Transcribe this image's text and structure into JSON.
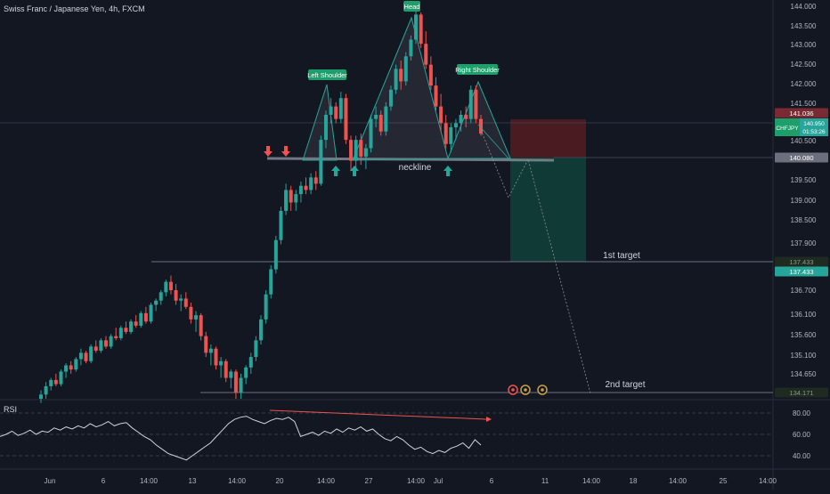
{
  "header": {
    "symbol_title": "Swiss Franc / Japanese Yen, 4h, FXCM"
  },
  "rsi": {
    "label": "RSI",
    "levels": [
      "80.00",
      "60.00",
      "40.00"
    ]
  },
  "colors": {
    "background": "#131722",
    "up": "#26a69a",
    "down": "#ef5350",
    "pattern_line": "#26a69a",
    "label_bg": "#1e9e6a",
    "stop_zone": "#4a1c22",
    "target_zone": "#0f3a36",
    "rsi_line": "#d1d4dc",
    "divergence": "#ef5350"
  },
  "chart_data": {
    "type": "candlestick",
    "title": "Swiss Franc / Japanese Yen, 4h, FXCM",
    "y_axis": {
      "range": [
        134.6,
        144.0
      ],
      "ticks": [
        "144.000",
        "143.500",
        "143.000",
        "142.500",
        "142.000",
        "141.500",
        "140.500",
        "139.500",
        "139.000",
        "138.500",
        "137.900",
        "136.700",
        "136.100",
        "135.600",
        "135.100",
        "134.650"
      ],
      "tick_values": [
        144.0,
        143.5,
        143.0,
        142.5,
        142.0,
        141.5,
        140.5,
        139.5,
        139.0,
        138.5,
        137.9,
        136.7,
        136.1,
        135.6,
        135.1,
        134.65
      ]
    },
    "x_axis": {
      "ticks": [
        "Jun",
        "6",
        "14:00",
        "13",
        "14:00",
        "20",
        "14:00",
        "27",
        "14:00",
        "Jul",
        "6",
        "11",
        "14:00",
        "18",
        "14:00",
        "25",
        "14:00"
      ]
    },
    "price_labels": {
      "stop": "141.036",
      "symbol": "CHFJPY",
      "last_price": "140.950",
      "countdown": "01:53:26",
      "neckline": "140.080",
      "first_target_a": "137.433",
      "first_target_b": "137.433",
      "second_target": "134.171"
    },
    "annotations": {
      "head": "Head",
      "left_shoulder": "Left Shoulder",
      "right_shoulder": "Right Shoulder",
      "neckline": "neckline",
      "first_target": "1st target",
      "second_target": "2nd target"
    },
    "candles_ohlc": [
      [
        134.6,
        134.8,
        134.5,
        134.7
      ],
      [
        134.7,
        135.0,
        134.6,
        134.9
      ],
      [
        134.9,
        135.1,
        134.8,
        135.05
      ],
      [
        135.05,
        135.2,
        134.9,
        134.95
      ],
      [
        134.95,
        135.3,
        134.9,
        135.25
      ],
      [
        135.25,
        135.45,
        135.1,
        135.4
      ],
      [
        135.4,
        135.5,
        135.2,
        135.3
      ],
      [
        135.3,
        135.6,
        135.25,
        135.55
      ],
      [
        135.55,
        135.8,
        135.4,
        135.7
      ],
      [
        135.7,
        135.75,
        135.45,
        135.5
      ],
      [
        135.5,
        135.9,
        135.45,
        135.85
      ],
      [
        135.85,
        136.0,
        135.7,
        135.75
      ],
      [
        135.75,
        136.05,
        135.7,
        136.0
      ],
      [
        136.0,
        136.1,
        135.8,
        135.85
      ],
      [
        135.85,
        136.15,
        135.8,
        136.1
      ],
      [
        136.1,
        136.3,
        136.0,
        136.05
      ],
      [
        136.05,
        136.35,
        136.0,
        136.3
      ],
      [
        136.3,
        136.45,
        136.15,
        136.2
      ],
      [
        136.2,
        136.5,
        136.15,
        136.45
      ],
      [
        136.45,
        136.6,
        136.3,
        136.35
      ],
      [
        136.35,
        136.7,
        136.3,
        136.65
      ],
      [
        136.65,
        136.8,
        136.4,
        136.45
      ],
      [
        136.45,
        136.9,
        136.4,
        136.85
      ],
      [
        136.85,
        137.0,
        136.7,
        136.95
      ],
      [
        136.95,
        137.2,
        136.85,
        137.15
      ],
      [
        137.15,
        137.45,
        137.05,
        137.4
      ],
      [
        137.4,
        137.55,
        137.1,
        137.2
      ],
      [
        137.2,
        137.35,
        136.85,
        136.95
      ],
      [
        136.95,
        137.1,
        136.7,
        137.0
      ],
      [
        137.0,
        137.15,
        136.75,
        136.8
      ],
      [
        136.8,
        136.9,
        136.4,
        136.5
      ],
      [
        136.5,
        136.7,
        136.2,
        136.6
      ],
      [
        136.6,
        136.65,
        136.0,
        136.1
      ],
      [
        136.1,
        136.2,
        135.6,
        135.7
      ],
      [
        135.7,
        135.9,
        135.4,
        135.8
      ],
      [
        135.8,
        135.85,
        135.3,
        135.4
      ],
      [
        135.4,
        135.6,
        135.1,
        135.5
      ],
      [
        135.5,
        135.55,
        135.0,
        135.1
      ],
      [
        135.1,
        135.3,
        134.85,
        135.25
      ],
      [
        135.25,
        135.3,
        134.6,
        134.75
      ],
      [
        134.75,
        135.2,
        134.6,
        135.1
      ],
      [
        135.1,
        135.4,
        134.95,
        135.35
      ],
      [
        135.35,
        135.7,
        135.2,
        135.6
      ],
      [
        135.6,
        136.1,
        135.5,
        136.0
      ],
      [
        136.0,
        136.6,
        135.9,
        136.5
      ],
      [
        136.5,
        137.2,
        136.4,
        137.1
      ],
      [
        137.1,
        137.8,
        137.0,
        137.7
      ],
      [
        137.7,
        138.5,
        137.6,
        138.4
      ],
      [
        138.4,
        139.2,
        138.3,
        139.1
      ],
      [
        139.1,
        139.75,
        139.0,
        139.6
      ],
      [
        139.6,
        139.7,
        139.1,
        139.3
      ],
      [
        139.3,
        139.6,
        139.1,
        139.5
      ],
      [
        139.5,
        139.8,
        139.3,
        139.7
      ],
      [
        139.7,
        139.9,
        139.5,
        139.6
      ],
      [
        139.6,
        140.0,
        139.5,
        139.9
      ],
      [
        139.9,
        140.05,
        139.6,
        139.75
      ],
      [
        139.75,
        140.9,
        139.7,
        140.8
      ],
      [
        140.8,
        141.5,
        140.6,
        141.4
      ],
      [
        141.4,
        141.8,
        141.2,
        141.6
      ],
      [
        141.6,
        141.7,
        141.2,
        141.3
      ],
      [
        141.3,
        141.95,
        141.2,
        141.8
      ],
      [
        141.8,
        141.9,
        140.7,
        140.8
      ],
      [
        140.8,
        140.9,
        140.05,
        140.3
      ],
      [
        140.3,
        140.9,
        140.1,
        140.8
      ],
      [
        140.8,
        140.95,
        140.2,
        140.4
      ],
      [
        140.4,
        140.7,
        140.1,
        140.6
      ],
      [
        140.6,
        141.4,
        140.5,
        141.3
      ],
      [
        141.3,
        141.6,
        141.1,
        141.4
      ],
      [
        141.4,
        141.5,
        140.9,
        141.0
      ],
      [
        141.0,
        141.7,
        140.9,
        141.6
      ],
      [
        141.6,
        142.1,
        141.5,
        142.0
      ],
      [
        142.0,
        142.6,
        141.9,
        142.5
      ],
      [
        142.5,
        142.7,
        142.0,
        142.2
      ],
      [
        142.2,
        142.9,
        142.1,
        142.8
      ],
      [
        142.8,
        143.3,
        142.7,
        143.2
      ],
      [
        143.2,
        143.9,
        143.1,
        143.8
      ],
      [
        143.8,
        143.85,
        143.0,
        143.1
      ],
      [
        143.1,
        143.4,
        142.5,
        142.6
      ],
      [
        142.6,
        142.8,
        142.0,
        142.1
      ],
      [
        142.1,
        142.3,
        141.5,
        141.6
      ],
      [
        141.6,
        141.9,
        141.0,
        141.2
      ],
      [
        141.2,
        141.4,
        140.6,
        140.7
      ],
      [
        140.7,
        141.2,
        140.5,
        141.1
      ],
      [
        141.1,
        141.3,
        140.8,
        141.2
      ],
      [
        141.2,
        141.5,
        141.0,
        141.4
      ],
      [
        141.4,
        141.6,
        141.1,
        141.3
      ],
      [
        141.3,
        142.1,
        141.2,
        142.0
      ],
      [
        142.0,
        142.1,
        141.2,
        141.3
      ],
      [
        141.3,
        141.4,
        140.9,
        140.95
      ]
    ],
    "rsi_values": [
      58,
      60,
      63,
      59,
      61,
      64,
      60,
      63,
      62,
      66,
      64,
      67,
      65,
      68,
      66,
      70,
      67,
      69,
      72,
      68,
      70,
      71,
      66,
      62,
      58,
      55,
      50,
      46,
      42,
      40,
      38,
      36,
      40,
      44,
      48,
      52,
      58,
      64,
      70,
      74,
      76,
      77,
      74,
      72,
      70,
      73,
      75,
      74,
      76,
      72,
      58,
      60,
      62,
      59,
      63,
      61,
      65,
      62,
      66,
      64,
      67,
      63,
      65,
      60,
      56,
      54,
      58,
      55,
      50,
      46,
      48,
      44,
      42,
      45,
      43,
      47,
      49,
      52,
      47,
      55,
      50
    ],
    "divergence_labels": []
  }
}
